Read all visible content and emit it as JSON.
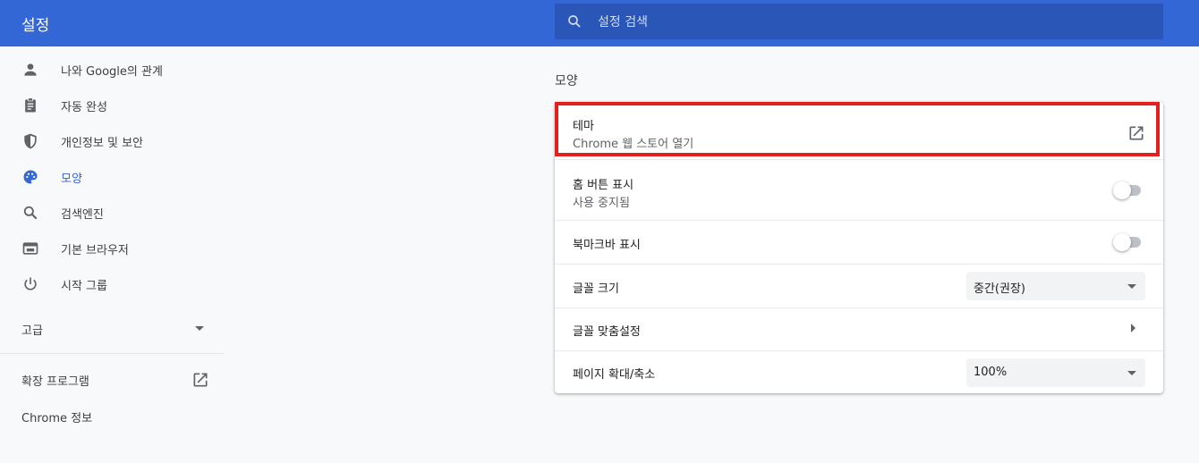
{
  "header": {
    "title": "설정",
    "search_placeholder": "설정 검색",
    "search_icon": "search-icon"
  },
  "sidebar": {
    "items": [
      {
        "label": "나와 Google의 관계",
        "icon": "person-icon",
        "active": false
      },
      {
        "label": "자동 완성",
        "icon": "clipboard-icon",
        "active": false
      },
      {
        "label": "개인정보 및 보안",
        "icon": "shield-icon",
        "active": false
      },
      {
        "label": "모양",
        "icon": "palette-icon",
        "active": true
      },
      {
        "label": "검색엔진",
        "icon": "search-icon",
        "active": false
      },
      {
        "label": "기본 브라우저",
        "icon": "browser-window-icon",
        "active": false
      },
      {
        "label": "시작 그룹",
        "icon": "power-icon",
        "active": false
      }
    ],
    "advanced_label": "고급",
    "extensions_label": "확장 프로그램",
    "about_label": "Chrome 정보"
  },
  "main": {
    "section_title": "모양",
    "theme": {
      "title": "테마",
      "subtitle": "Chrome 웹 스토어 열기"
    },
    "home_button": {
      "title": "홈 버튼 표시",
      "subtitle": "사용 중지됨",
      "enabled": false
    },
    "bookmarks_bar": {
      "title": "북마크바 표시",
      "enabled": false
    },
    "font_size": {
      "title": "글꼴 크기",
      "value": "중간(권장)"
    },
    "customize_fonts": {
      "title": "글꼴 맞춤설정"
    },
    "page_zoom": {
      "title": "페이지 확대/축소",
      "value": "100%"
    }
  },
  "colors": {
    "header": "#3367d6",
    "search_bg": "#2a56b8",
    "accent": "#3367d6",
    "highlight_border": "#e3201b"
  }
}
